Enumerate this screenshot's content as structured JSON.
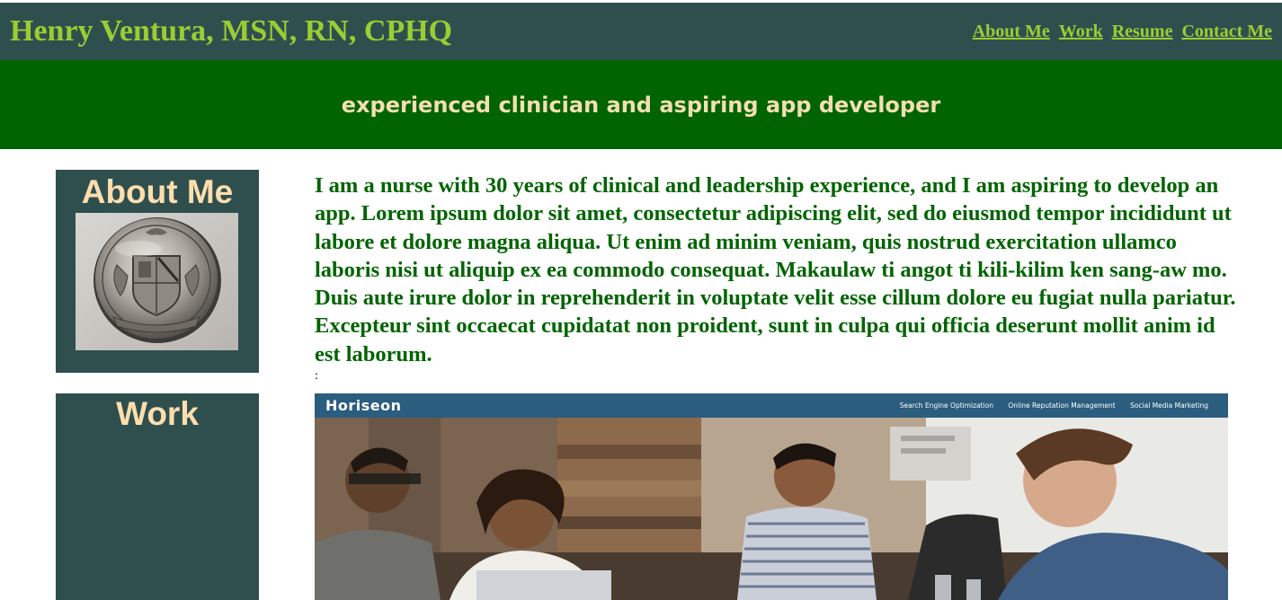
{
  "header": {
    "title": "Henry Ventura, MSN, RN, CPHQ",
    "nav": [
      "About Me",
      "Work",
      "Resume",
      "Contact Me"
    ]
  },
  "banner": {
    "tagline": "experienced clinician and aspiring app developer"
  },
  "sections": {
    "about": {
      "heading": "About Me",
      "text": "I am a nurse with 30 years of clinical and leadership experience, and I am aspiring to develop an app. Lorem ipsum dolor sit amet, consectetur adipiscing elit, sed do eiusmod tempor incididunt ut labore et dolore magna aliqua. Ut enim ad minim veniam, quis nostrud exercitation ullamco laboris nisi ut aliquip ex ea commodo consequat. Makaulaw ti angot ti kili-kilim ken sang-aw mo. Duis aute irure dolor in reprehenderit in voluptate velit esse cillum dolore eu fugiat nulla pariatur. Excepteur sint occaecat cupidatat non proident, sunt in culpa qui officia deserunt mollit anim id est laborum.",
      "separator": ":"
    },
    "work": {
      "heading": "Work",
      "project": {
        "brand": "Horiseon",
        "links": [
          "Search Engine Optimization",
          "Online Reputation Management",
          "Social Media Marketing"
        ]
      }
    }
  },
  "colors": {
    "header_bg": "#2f4f4f",
    "title": "#9acd32",
    "banner_bg": "#006400",
    "tagline": "#f5deb3",
    "card_bg": "#2f4f4f",
    "card_heading": "#ffdead",
    "body_text": "#006400"
  },
  "icons": {
    "about_image": "nursing-pin-photo",
    "work_image": "horiseon-screenshot"
  }
}
